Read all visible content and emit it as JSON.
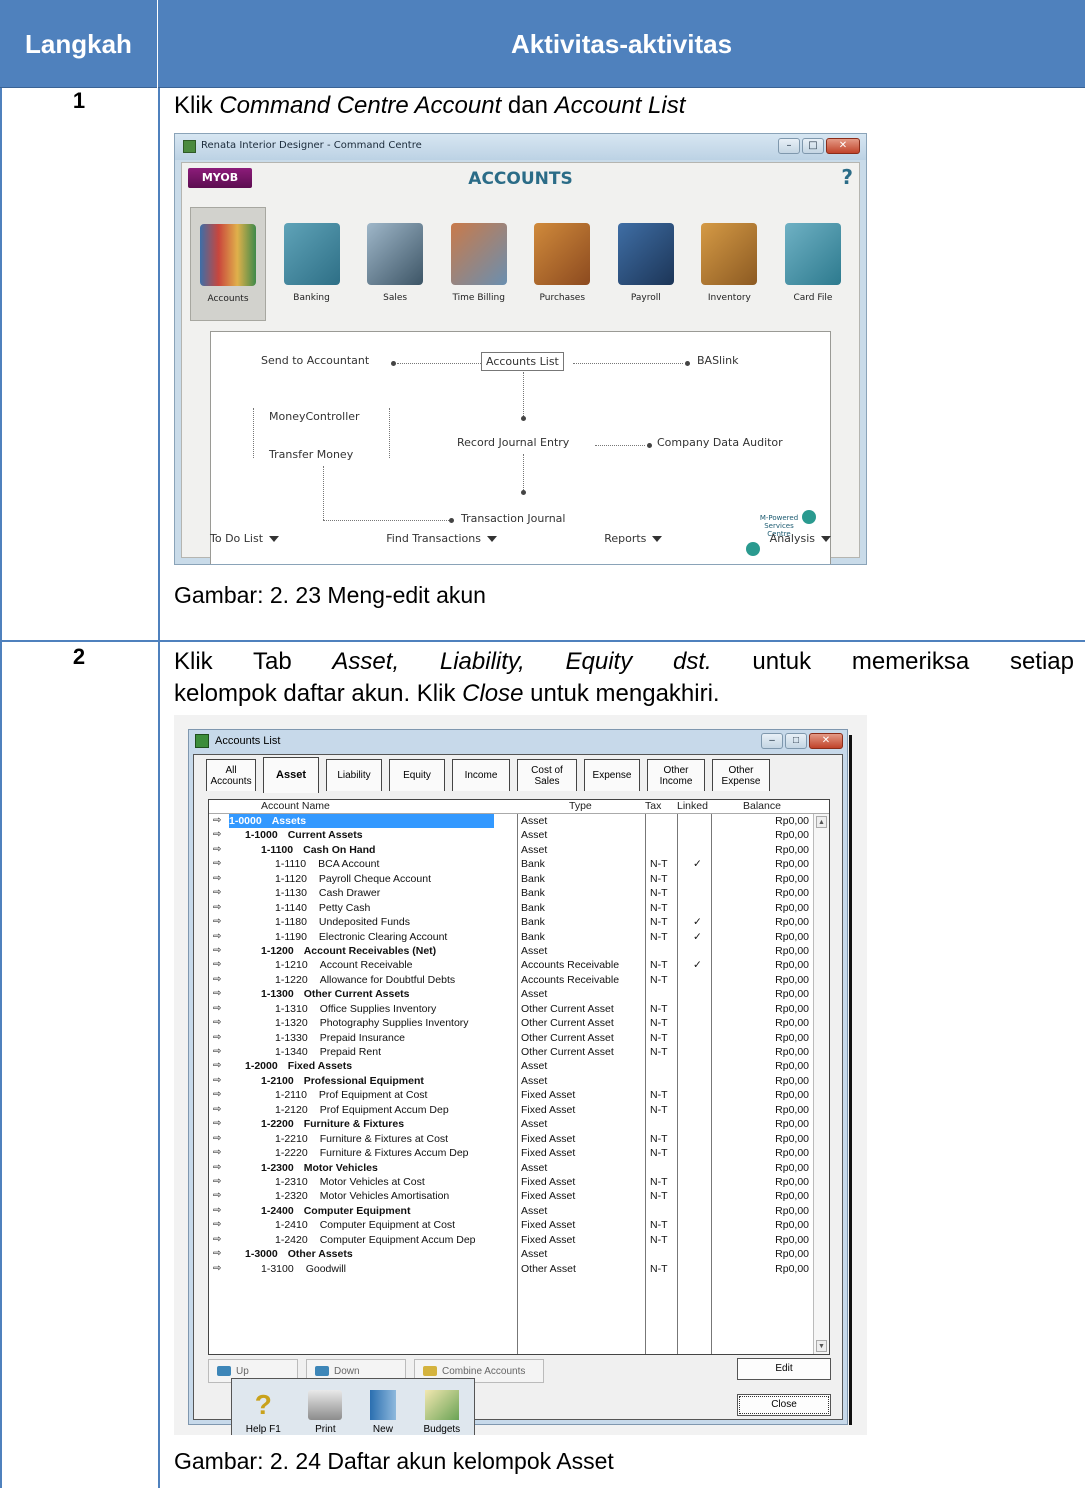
{
  "header": {
    "col_step": "Langkah",
    "col_activity": "Aktivitas-aktivitas"
  },
  "steps": [
    {
      "number": "1",
      "instruction_html": "Klik <i>Command Centre Account</i> dan <i>Account List</i>",
      "caption": "Gambar: 2. 23 Meng-edit akun"
    },
    {
      "number": "2",
      "instruction_line1": "Klik Tab <i>Asset, Liability, Equity dst.</i> untuk memeriksa setiap",
      "instruction_line2": "kelompok daftar akun. Klik <i>Close</i> untuk mengakhiri.",
      "caption": "Gambar: 2. 24 Daftar akun kelompok Asset"
    }
  ],
  "command_centre": {
    "window_title": "Renata Interior Designer - Command Centre",
    "logo": "MYOB",
    "heading": "ACCOUNTS",
    "help": "?",
    "modules": [
      "Accounts",
      "Banking",
      "Sales",
      "Time Billing",
      "Purchases",
      "Payroll",
      "Inventory",
      "Card File"
    ],
    "flow": {
      "send_to_accountant": "Send to Accountant",
      "accounts_list": "Accounts List",
      "baslink": "BASlink",
      "money_controller": "MoneyController",
      "transfer_money": "Transfer Money",
      "record_journal_entry": "Record Journal Entry",
      "company_data_auditor": "Company Data Auditor",
      "transaction_journal": "Transaction Journal",
      "mpsc": "M-Powered Services Centre"
    },
    "bottom": [
      "To Do List",
      "Find Transactions",
      "Reports",
      "Analysis"
    ]
  },
  "accounts_list": {
    "window_title": "Accounts List",
    "tabs": [
      "All Accounts",
      "Asset",
      "Liability",
      "Equity",
      "Income",
      "Cost of Sales",
      "Expense",
      "Other Income",
      "Other Expense"
    ],
    "columns": {
      "name": "Account Name",
      "type": "Type",
      "tax": "Tax",
      "linked": "Linked",
      "balance": "Balance"
    },
    "rows": [
      {
        "lvl": 0,
        "num": "1-0000",
        "name": "Assets",
        "type": "Asset",
        "tax": "",
        "linked": "",
        "bal": "Rp0,00"
      },
      {
        "lvl": 1,
        "num": "1-1000",
        "name": "Current Assets",
        "type": "Asset",
        "tax": "",
        "linked": "",
        "bal": "Rp0,00"
      },
      {
        "lvl": 2,
        "num": "1-1100",
        "name": "Cash On Hand",
        "type": "Asset",
        "tax": "",
        "linked": "",
        "bal": "Rp0,00"
      },
      {
        "lvl": 3,
        "num": "1-1110",
        "name": "BCA Account",
        "type": "Bank",
        "tax": "N-T",
        "linked": "✓",
        "bal": "Rp0,00"
      },
      {
        "lvl": 3,
        "num": "1-1120",
        "name": "Payroll Cheque Account",
        "type": "Bank",
        "tax": "N-T",
        "linked": "",
        "bal": "Rp0,00"
      },
      {
        "lvl": 3,
        "num": "1-1130",
        "name": "Cash Drawer",
        "type": "Bank",
        "tax": "N-T",
        "linked": "",
        "bal": "Rp0,00"
      },
      {
        "lvl": 3,
        "num": "1-1140",
        "name": "Petty Cash",
        "type": "Bank",
        "tax": "N-T",
        "linked": "",
        "bal": "Rp0,00"
      },
      {
        "lvl": 3,
        "num": "1-1180",
        "name": "Undeposited Funds",
        "type": "Bank",
        "tax": "N-T",
        "linked": "✓",
        "bal": "Rp0,00"
      },
      {
        "lvl": 3,
        "num": "1-1190",
        "name": "Electronic Clearing Account",
        "type": "Bank",
        "tax": "N-T",
        "linked": "✓",
        "bal": "Rp0,00"
      },
      {
        "lvl": 2,
        "num": "1-1200",
        "name": "Account Receivables (Net)",
        "type": "Asset",
        "tax": "",
        "linked": "",
        "bal": "Rp0,00"
      },
      {
        "lvl": 3,
        "num": "1-1210",
        "name": "Account Receivable",
        "type": "Accounts Receivable",
        "tax": "N-T",
        "linked": "✓",
        "bal": "Rp0,00"
      },
      {
        "lvl": 3,
        "num": "1-1220",
        "name": "Allowance for Doubtful Debts",
        "type": "Accounts Receivable",
        "tax": "N-T",
        "linked": "",
        "bal": "Rp0,00"
      },
      {
        "lvl": 2,
        "num": "1-1300",
        "name": "Other Current Assets",
        "type": "Asset",
        "tax": "",
        "linked": "",
        "bal": "Rp0,00"
      },
      {
        "lvl": 3,
        "num": "1-1310",
        "name": "Office Supplies Inventory",
        "type": "Other Current Asset",
        "tax": "N-T",
        "linked": "",
        "bal": "Rp0,00"
      },
      {
        "lvl": 3,
        "num": "1-1320",
        "name": "Photography Supplies Inventory",
        "type": "Other Current Asset",
        "tax": "N-T",
        "linked": "",
        "bal": "Rp0,00"
      },
      {
        "lvl": 3,
        "num": "1-1330",
        "name": "Prepaid Insurance",
        "type": "Other Current Asset",
        "tax": "N-T",
        "linked": "",
        "bal": "Rp0,00"
      },
      {
        "lvl": 3,
        "num": "1-1340",
        "name": "Prepaid Rent",
        "type": "Other Current Asset",
        "tax": "N-T",
        "linked": "",
        "bal": "Rp0,00"
      },
      {
        "lvl": 1,
        "num": "1-2000",
        "name": "Fixed Assets",
        "type": "Asset",
        "tax": "",
        "linked": "",
        "bal": "Rp0,00"
      },
      {
        "lvl": 2,
        "num": "1-2100",
        "name": "Professional Equipment",
        "type": "Asset",
        "tax": "",
        "linked": "",
        "bal": "Rp0,00"
      },
      {
        "lvl": 3,
        "num": "1-2110",
        "name": "Prof Equipment at Cost",
        "type": "Fixed Asset",
        "tax": "N-T",
        "linked": "",
        "bal": "Rp0,00"
      },
      {
        "lvl": 3,
        "num": "1-2120",
        "name": "Prof Equipment Accum Dep",
        "type": "Fixed Asset",
        "tax": "N-T",
        "linked": "",
        "bal": "Rp0,00"
      },
      {
        "lvl": 2,
        "num": "1-2200",
        "name": "Furniture & Fixtures",
        "type": "Asset",
        "tax": "",
        "linked": "",
        "bal": "Rp0,00"
      },
      {
        "lvl": 3,
        "num": "1-2210",
        "name": "Furniture & Fixtures at Cost",
        "type": "Fixed Asset",
        "tax": "N-T",
        "linked": "",
        "bal": "Rp0,00"
      },
      {
        "lvl": 3,
        "num": "1-2220",
        "name": "Furniture & Fixtures Accum Dep",
        "type": "Fixed Asset",
        "tax": "N-T",
        "linked": "",
        "bal": "Rp0,00"
      },
      {
        "lvl": 2,
        "num": "1-2300",
        "name": "Motor Vehicles",
        "type": "Asset",
        "tax": "",
        "linked": "",
        "bal": "Rp0,00"
      },
      {
        "lvl": 3,
        "num": "1-2310",
        "name": "Motor Vehicles at Cost",
        "type": "Fixed Asset",
        "tax": "N-T",
        "linked": "",
        "bal": "Rp0,00"
      },
      {
        "lvl": 3,
        "num": "1-2320",
        "name": "Motor Vehicles Amortisation",
        "type": "Fixed Asset",
        "tax": "N-T",
        "linked": "",
        "bal": "Rp0,00"
      },
      {
        "lvl": 2,
        "num": "1-2400",
        "name": "Computer Equipment",
        "type": "Asset",
        "tax": "",
        "linked": "",
        "bal": "Rp0,00"
      },
      {
        "lvl": 3,
        "num": "1-2410",
        "name": "Computer Equipment at Cost",
        "type": "Fixed Asset",
        "tax": "N-T",
        "linked": "",
        "bal": "Rp0,00"
      },
      {
        "lvl": 3,
        "num": "1-2420",
        "name": "Computer Equipment Accum Dep",
        "type": "Fixed Asset",
        "tax": "N-T",
        "linked": "",
        "bal": "Rp0,00"
      },
      {
        "lvl": 1,
        "num": "1-3000",
        "name": "Other Assets",
        "type": "Asset",
        "tax": "",
        "linked": "",
        "bal": "Rp0,00"
      },
      {
        "lvl": 2,
        "num": "1-3100",
        "name": "Goodwill",
        "type": "Other Asset",
        "tax": "N-T",
        "linked": "",
        "bal": "Rp0,00",
        "plain": true
      }
    ],
    "nav_buttons": [
      "Up",
      "Down",
      "Combine Accounts"
    ],
    "toolbar": [
      "Help F1",
      "Print",
      "New",
      "Budgets"
    ],
    "edit_label": "Edit",
    "close_label": "Close"
  },
  "colors": {
    "header_bg": "#4f81bd",
    "header_text": "#ffffff",
    "selection": "#3399ff"
  }
}
